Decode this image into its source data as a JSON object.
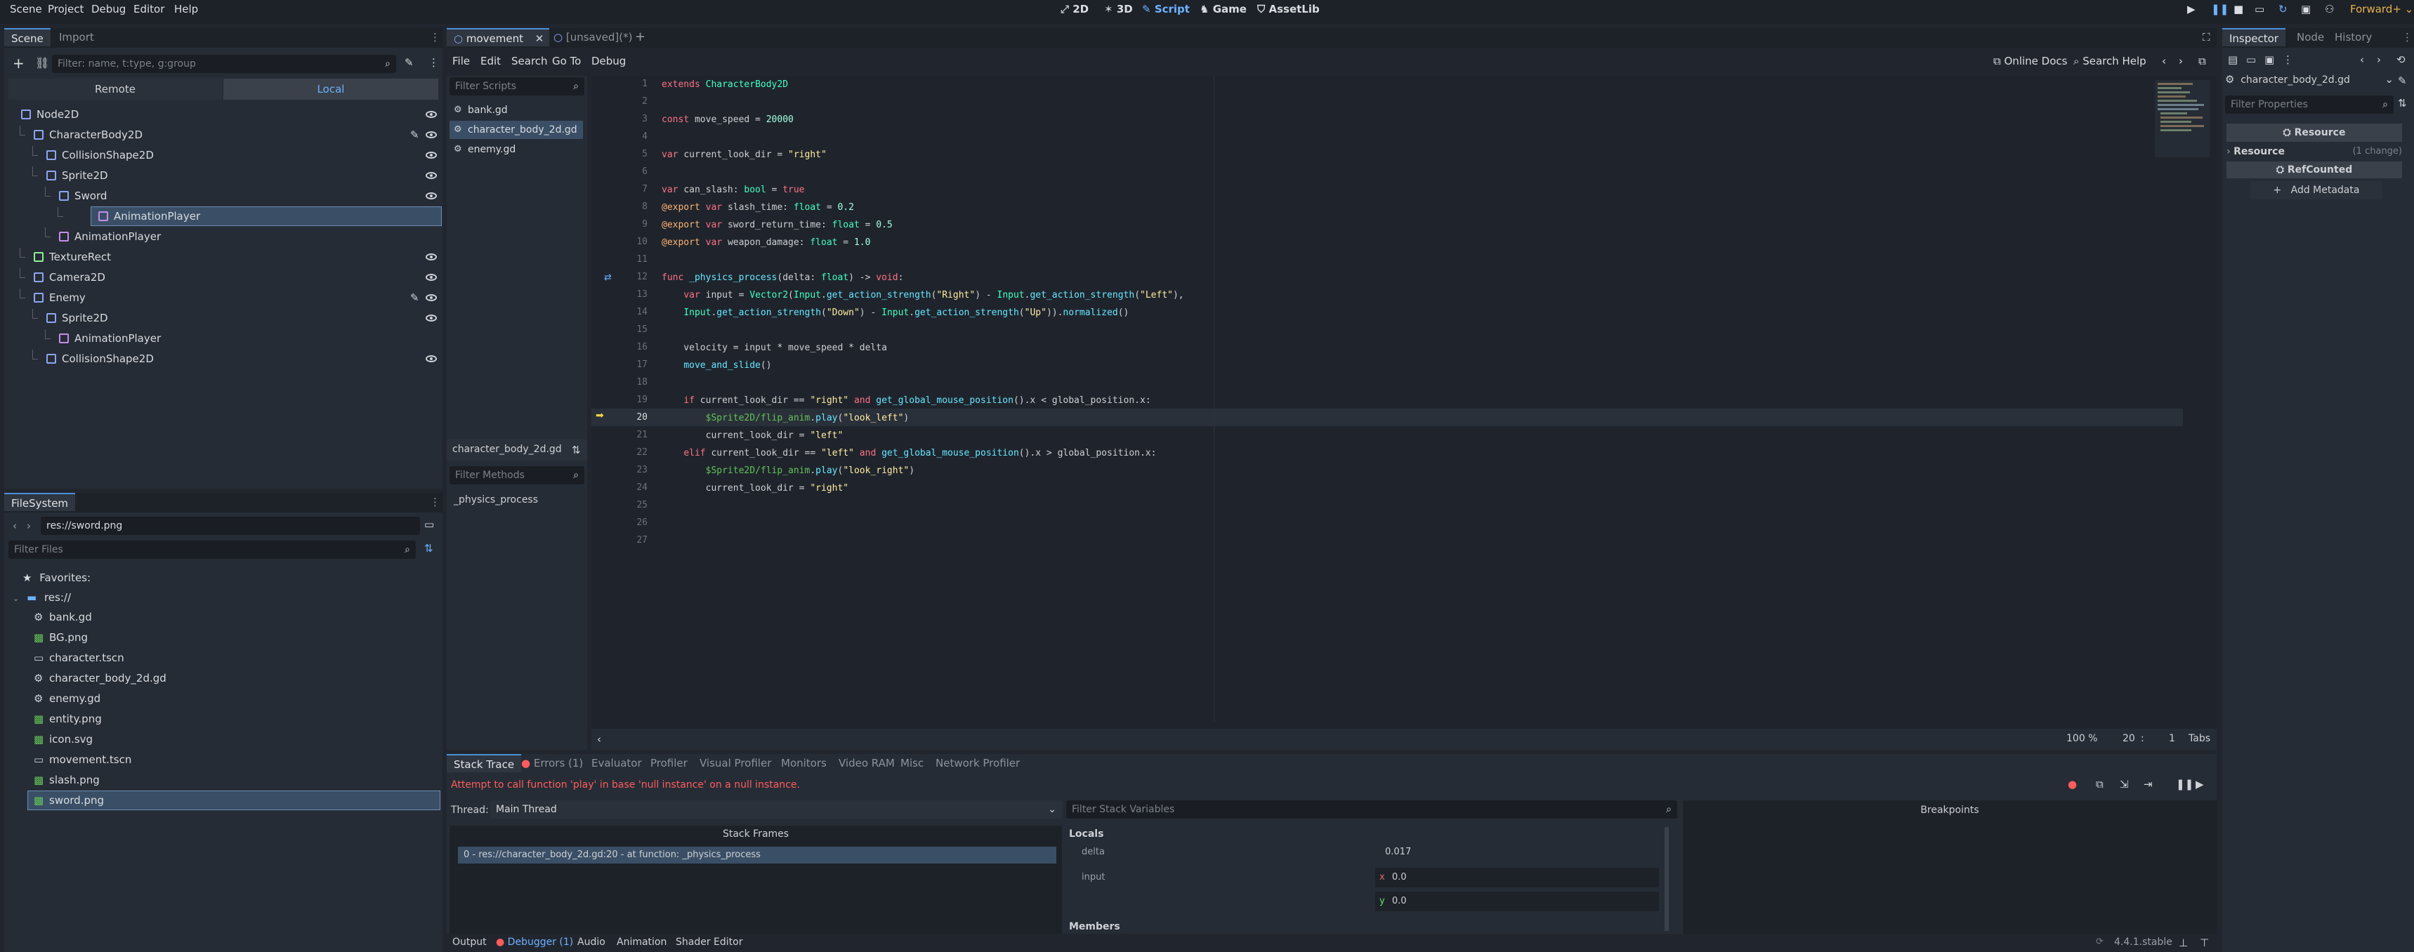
{
  "menubar": {
    "items": [
      "Scene",
      "Project",
      "Debug",
      "Editor",
      "Help"
    ],
    "workspaces": [
      "2D",
      "3D",
      "Script",
      "Game",
      "AssetLib"
    ],
    "renderer": "Forward+"
  },
  "scene_dock": {
    "tabs": [
      "Scene",
      "Import"
    ],
    "filter_placeholder": "Filter: name, t:type, g:group",
    "remote_label": "Remote",
    "local_label": "Local",
    "nodes": [
      {
        "name": "Node2D",
        "depth": 0,
        "icon": "node2d-icon",
        "color": "#8da5f3",
        "eye": true,
        "script": false
      },
      {
        "name": "CharacterBody2D",
        "depth": 1,
        "icon": "characterbody2d-icon",
        "color": "#8da5f3",
        "eye": true,
        "script": true
      },
      {
        "name": "CollisionShape2D",
        "depth": 2,
        "icon": "collisionshape2d-icon",
        "color": "#8da5f3",
        "eye": true,
        "script": false
      },
      {
        "name": "Sprite2D",
        "depth": 2,
        "icon": "sprite2d-icon",
        "color": "#8da5f3",
        "eye": true,
        "script": false
      },
      {
        "name": "Sword",
        "depth": 3,
        "icon": "sprite2d-icon",
        "color": "#8da5f3",
        "eye": true,
        "script": false
      },
      {
        "name": "AnimationPlayer",
        "depth": 4,
        "icon": "animationplayer-icon",
        "color": "#c48ee8",
        "eye": false,
        "script": false,
        "selected": true
      },
      {
        "name": "AnimationPlayer",
        "depth": 3,
        "icon": "animationplayer-icon",
        "color": "#c48ee8",
        "eye": false,
        "script": false
      },
      {
        "name": "TextureRect",
        "depth": 1,
        "icon": "texturerect-icon",
        "color": "#8eef97",
        "eye": true,
        "script": false
      },
      {
        "name": "Camera2D",
        "depth": 1,
        "icon": "camera2d-icon",
        "color": "#8da5f3",
        "eye": true,
        "script": false
      },
      {
        "name": "Enemy",
        "depth": 1,
        "icon": "characterbody2d-icon",
        "color": "#8da5f3",
        "eye": true,
        "script": true
      },
      {
        "name": "Sprite2D",
        "depth": 2,
        "icon": "sprite2d-icon",
        "color": "#8da5f3",
        "eye": true,
        "script": false
      },
      {
        "name": "AnimationPlayer",
        "depth": 3,
        "icon": "animationplayer-icon",
        "color": "#c48ee8",
        "eye": false,
        "script": false
      },
      {
        "name": "CollisionShape2D",
        "depth": 2,
        "icon": "collisionshape2d-icon",
        "color": "#8da5f3",
        "eye": true,
        "script": false
      }
    ]
  },
  "filesystem_dock": {
    "title": "FileSystem",
    "path": "res://sword.png",
    "filter_placeholder": "Filter Files",
    "favorites_label": "Favorites:",
    "root_label": "res://",
    "files": [
      {
        "name": "bank.gd",
        "icon": "gear-icon"
      },
      {
        "name": "BG.png",
        "icon": "image-icon"
      },
      {
        "name": "character.tscn",
        "icon": "scene-icon"
      },
      {
        "name": "character_body_2d.gd",
        "icon": "gear-icon"
      },
      {
        "name": "enemy.gd",
        "icon": "gear-icon"
      },
      {
        "name": "entity.png",
        "icon": "image-icon"
      },
      {
        "name": "icon.svg",
        "icon": "image-icon"
      },
      {
        "name": "movement.tscn",
        "icon": "scene-icon"
      },
      {
        "name": "slash.png",
        "icon": "image-icon"
      },
      {
        "name": "sword.png",
        "icon": "image-icon",
        "selected": true
      }
    ]
  },
  "editor_tabs": {
    "tabs": [
      "movement",
      "[unsaved](*)"
    ]
  },
  "script_menu": {
    "items": [
      "File",
      "Edit",
      "Search",
      "Go To",
      "Debug"
    ],
    "online_docs": "Online Docs",
    "search_help": "Search Help"
  },
  "script_list": {
    "filter_placeholder": "Filter Scripts",
    "scripts": [
      "bank.gd",
      "character_body_2d.gd",
      "enemy.gd"
    ],
    "current": "character_body_2d.gd",
    "filter_methods_placeholder": "Filter Methods",
    "methods": [
      "_physics_process"
    ]
  },
  "code": {
    "lines": [
      {
        "n": "1",
        "tokens": [
          [
            "kw",
            "extends "
          ],
          [
            "tp",
            "CharacterBody2D"
          ]
        ]
      },
      {
        "n": "2",
        "tokens": []
      },
      {
        "n": "3",
        "tokens": [
          [
            "kw",
            "const "
          ],
          [
            "tx",
            "move_speed = "
          ],
          [
            "nm",
            "20000"
          ]
        ]
      },
      {
        "n": "4",
        "tokens": []
      },
      {
        "n": "5",
        "tokens": [
          [
            "kw",
            "var "
          ],
          [
            "tx",
            "current_look_dir = "
          ],
          [
            "st",
            "\"right\""
          ]
        ]
      },
      {
        "n": "6",
        "tokens": []
      },
      {
        "n": "7",
        "tokens": [
          [
            "kw",
            "var "
          ],
          [
            "tx",
            "can_slash: "
          ],
          [
            "tp",
            "bool"
          ],
          [
            "tx",
            " = "
          ],
          [
            "kw",
            "true"
          ]
        ]
      },
      {
        "n": "8",
        "tokens": [
          [
            "an",
            "@export "
          ],
          [
            "kw",
            "var "
          ],
          [
            "tx",
            "slash_time: "
          ],
          [
            "tp",
            "float"
          ],
          [
            "tx",
            " = "
          ],
          [
            "nm",
            "0.2"
          ]
        ]
      },
      {
        "n": "9",
        "tokens": [
          [
            "an",
            "@export "
          ],
          [
            "kw",
            "var "
          ],
          [
            "tx",
            "sword_return_time: "
          ],
          [
            "tp",
            "float"
          ],
          [
            "tx",
            " = "
          ],
          [
            "nm",
            "0.5"
          ]
        ]
      },
      {
        "n": "10",
        "tokens": [
          [
            "an",
            "@export "
          ],
          [
            "kw",
            "var "
          ],
          [
            "tx",
            "weapon_damage: "
          ],
          [
            "tp",
            "float"
          ],
          [
            "tx",
            " = "
          ],
          [
            "nm",
            "1.0"
          ]
        ]
      },
      {
        "n": "11",
        "tokens": []
      },
      {
        "n": "12",
        "tokens": [
          [
            "kw",
            "func "
          ],
          [
            "fn",
            "_physics_process"
          ],
          [
            "tx",
            "(delta: "
          ],
          [
            "tp",
            "float"
          ],
          [
            "tx",
            ") -> "
          ],
          [
            "kw",
            "void"
          ],
          [
            "tx",
            ":"
          ]
        ]
      },
      {
        "n": "13",
        "tokens": [
          [
            "tx",
            "    "
          ],
          [
            "kw",
            "var "
          ],
          [
            "tx",
            "input = "
          ],
          [
            "tp",
            "Vector2"
          ],
          [
            "tx",
            "("
          ],
          [
            "tp",
            "Input"
          ],
          [
            "tx",
            "."
          ],
          [
            "fn",
            "get_action_strength"
          ],
          [
            "tx",
            "("
          ],
          [
            "st",
            "\"Right\""
          ],
          [
            "tx",
            ") - "
          ],
          [
            "tp",
            "Input"
          ],
          [
            "tx",
            "."
          ],
          [
            "fn",
            "get_action_strength"
          ],
          [
            "tx",
            "("
          ],
          [
            "st",
            "\"Left\""
          ],
          [
            "tx",
            "),"
          ]
        ]
      },
      {
        "n": "14",
        "tokens": [
          [
            "tx",
            "    "
          ],
          [
            "tp",
            "Input"
          ],
          [
            "tx",
            "."
          ],
          [
            "fn",
            "get_action_strength"
          ],
          [
            "tx",
            "("
          ],
          [
            "st",
            "\"Down\""
          ],
          [
            "tx",
            ") - "
          ],
          [
            "tp",
            "Input"
          ],
          [
            "tx",
            "."
          ],
          [
            "fn",
            "get_action_strength"
          ],
          [
            "tx",
            "("
          ],
          [
            "st",
            "\"Up\""
          ],
          [
            "tx",
            "))."
          ],
          [
            "fn",
            "normalized"
          ],
          [
            "tx",
            "()"
          ]
        ]
      },
      {
        "n": "15",
        "tokens": []
      },
      {
        "n": "16",
        "tokens": [
          [
            "tx",
            "    velocity = input * move_speed * delta"
          ]
        ]
      },
      {
        "n": "17",
        "tokens": [
          [
            "tx",
            "    "
          ],
          [
            "fn",
            "move_and_slide"
          ],
          [
            "tx",
            "()"
          ]
        ]
      },
      {
        "n": "18",
        "tokens": []
      },
      {
        "n": "19",
        "tokens": [
          [
            "tx",
            "    "
          ],
          [
            "kw",
            "if "
          ],
          [
            "tx",
            "current_look_dir == "
          ],
          [
            "st",
            "\"right\""
          ],
          [
            "kw",
            " and "
          ],
          [
            "fn",
            "get_global_mouse_position"
          ],
          [
            "tx",
            "().x < global_position.x:"
          ]
        ]
      },
      {
        "n": "20",
        "tokens": [
          [
            "tx",
            "        "
          ],
          [
            "nd",
            "$Sprite2D/flip_anim"
          ],
          [
            "tx",
            "."
          ],
          [
            "fn",
            "play"
          ],
          [
            "tx",
            "("
          ],
          [
            "st",
            "\"look_left\""
          ],
          [
            "tx",
            ")"
          ]
        ]
      },
      {
        "n": "21",
        "tokens": [
          [
            "tx",
            "        current_look_dir = "
          ],
          [
            "st",
            "\"left\""
          ]
        ]
      },
      {
        "n": "22",
        "tokens": [
          [
            "tx",
            "    "
          ],
          [
            "kw",
            "elif "
          ],
          [
            "tx",
            "current_look_dir == "
          ],
          [
            "st",
            "\"left\""
          ],
          [
            "kw",
            " and "
          ],
          [
            "fn",
            "get_global_mouse_position"
          ],
          [
            "tx",
            "().x > global_position.x:"
          ]
        ]
      },
      {
        "n": "23",
        "tokens": [
          [
            "tx",
            "        "
          ],
          [
            "nd",
            "$Sprite2D/flip_anim"
          ],
          [
            "tx",
            "."
          ],
          [
            "fn",
            "play"
          ],
          [
            "tx",
            "("
          ],
          [
            "st",
            "\"look_right\""
          ],
          [
            "tx",
            ")"
          ]
        ]
      },
      {
        "n": "24",
        "tokens": [
          [
            "tx",
            "        current_look_dir = "
          ],
          [
            "st",
            "\"right\""
          ]
        ]
      },
      {
        "n": "25",
        "tokens": []
      },
      {
        "n": "26",
        "tokens": []
      },
      {
        "n": "27",
        "tokens": []
      }
    ],
    "current_line": "20"
  },
  "status": {
    "zoom": "100 %",
    "line": "20",
    "col": "1",
    "indent": "Tabs"
  },
  "inspector": {
    "tabs": [
      "Inspector",
      "Node",
      "History"
    ],
    "resource_name": "character_body_2d.gd",
    "filter_placeholder": "Filter Properties",
    "resource_header": "Resource",
    "section_resource": "Resource",
    "section_changes": "(1 change)",
    "refcounted": "RefCounted",
    "add_metadata": "Add Metadata"
  },
  "debugger": {
    "tabs": [
      "Stack Trace",
      "Errors (1)",
      "Evaluator",
      "Profiler",
      "Visual Profiler",
      "Monitors",
      "Video RAM",
      "Misc",
      "Network Profiler"
    ],
    "error_message": "Attempt to call function 'play' in base 'null instance' on a null instance.",
    "thread_label": "Thread:",
    "thread_value": "Main Thread",
    "stack_frames_title": "Stack Frames",
    "stack_frames": [
      "0 - res://character_body_2d.gd:20 - at function: _physics_process"
    ],
    "filter_vars_placeholder": "Filter Stack Variables",
    "locals_label": "Locals",
    "variables": [
      {
        "name": "delta",
        "value": "0.017"
      },
      {
        "name": "input",
        "x": "0.0",
        "y": "0.0"
      }
    ],
    "members_label": "Members",
    "breakpoints_title": "Breakpoints"
  },
  "bottom_panel": {
    "tabs": [
      "Output",
      "Debugger (1)",
      "Audio",
      "Animation",
      "Shader Editor"
    ],
    "version": "4.4.1.stable"
  },
  "colors": {
    "accent": "#4a90d9",
    "error": "#ff5d5d",
    "selection": "#3a4f66"
  }
}
